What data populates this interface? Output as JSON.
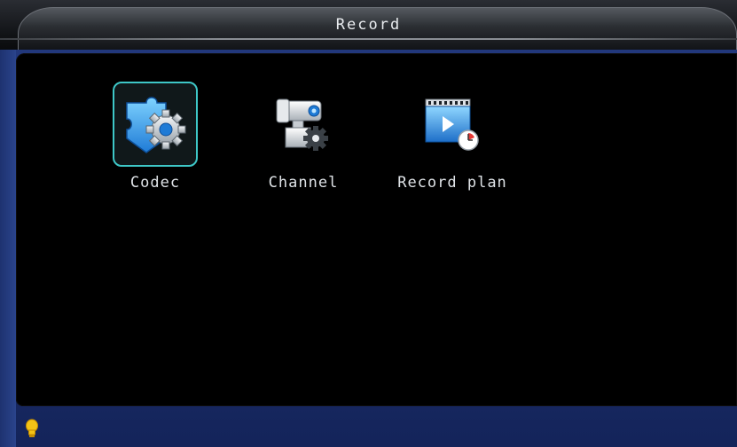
{
  "window": {
    "title": "Record"
  },
  "menu": {
    "items": [
      {
        "label": "Codec",
        "icon": "codec-icon",
        "selected": true
      },
      {
        "label": "Channel",
        "icon": "channel-icon",
        "selected": false
      },
      {
        "label": "Record plan",
        "icon": "record-plan-icon",
        "selected": false
      }
    ]
  },
  "status": {
    "icon": "lightbulb-icon"
  },
  "colors": {
    "selection_border": "#3ec7c7",
    "panel_background": "#000000",
    "frame_blue": "#1b2d6b",
    "icon_blue": "#2a8fe0"
  }
}
